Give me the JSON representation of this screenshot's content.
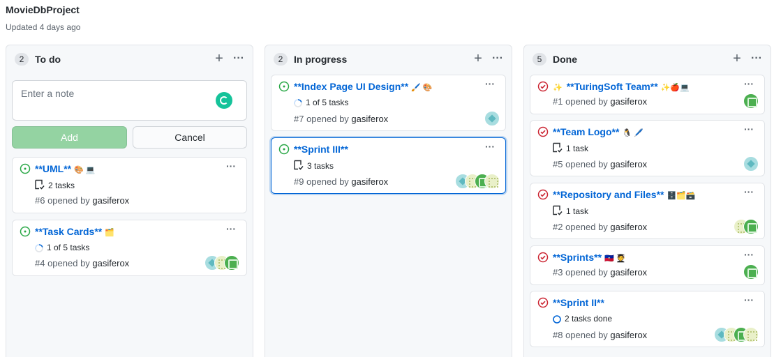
{
  "project": {
    "title": "MovieDbProject",
    "updated": "Updated 4 days ago"
  },
  "colors": {
    "open_green": "#28a745",
    "closed_red": "#cb2431",
    "link_blue": "#0366d6",
    "progress_blue": "#0366d6"
  },
  "columns": [
    {
      "count": "2",
      "name": "To do",
      "note": {
        "placeholder": "Enter a note",
        "add_label": "Add",
        "cancel_label": "Cancel"
      },
      "cards": [
        {
          "status": "open",
          "title": "**UML**",
          "emoji": "🎨 💻",
          "tasks": "2 tasks",
          "task_icon": "checklist-icon",
          "meta_prefix": "#6 opened by",
          "author": "gasiferox",
          "avatars": []
        },
        {
          "status": "open",
          "title": "**Task Cards**",
          "emoji": "🗂️",
          "tasks": "1 of 5 tasks",
          "task_icon": "progress-icon",
          "progress": 0.2,
          "meta_prefix": "#4 opened by",
          "author": "gasiferox",
          "avatars": [
            "teal",
            "cream",
            "green"
          ]
        }
      ]
    },
    {
      "count": "2",
      "name": "In progress",
      "cards": [
        {
          "status": "open",
          "title": "**Index Page UI Design**",
          "emoji": "🖌️ 🎨",
          "tasks": "1 of 5 tasks",
          "task_icon": "progress-icon",
          "progress": 0.2,
          "meta_prefix": "#7 opened by",
          "author": "gasiferox",
          "avatars": [
            "teal"
          ]
        },
        {
          "status": "open",
          "title": "**Sprint III**",
          "emoji": "",
          "tasks": "3 tasks",
          "task_icon": "checklist-icon",
          "meta_prefix": "#9 opened by",
          "author": "gasiferox",
          "avatars": [
            "teal",
            "cream",
            "green",
            "cream"
          ],
          "selected": true
        }
      ]
    },
    {
      "count": "5",
      "name": "Done",
      "cards": [
        {
          "status": "closed",
          "title": "**TuringSoft Team**",
          "prefix_emoji": "✨",
          "emoji": "✨🍎💻",
          "tasks": "",
          "meta_prefix": "#1 opened by",
          "author": "gasiferox",
          "avatars": [
            "green"
          ]
        },
        {
          "status": "closed",
          "title": "**Team Logo**",
          "emoji": "🐧 🖊️",
          "tasks": "1 task",
          "task_icon": "checklist-icon",
          "meta_prefix": "#5 opened by",
          "author": "gasiferox",
          "avatars": [
            "teal"
          ]
        },
        {
          "status": "closed",
          "title": "**Repository and Files**",
          "emoji": "🗄️🗂️🗃️",
          "tasks": "1 task",
          "task_icon": "checklist-icon",
          "meta_prefix": "#2 opened by",
          "author": "gasiferox",
          "avatars": [
            "cream",
            "green"
          ]
        },
        {
          "status": "closed",
          "title": "**Sprints**",
          "emoji": "🇭🇹 🧑‍🎓",
          "tasks": "",
          "meta_prefix": "#3 opened by",
          "author": "gasiferox",
          "avatars": [
            "green"
          ]
        },
        {
          "status": "closed",
          "title": "**Sprint II**",
          "emoji": "",
          "tasks": "2 tasks done",
          "task_icon": "ring-icon",
          "meta_prefix": "#8 opened by",
          "author": "gasiferox",
          "avatars": [
            "teal",
            "cream",
            "green",
            "cream"
          ]
        }
      ]
    }
  ]
}
